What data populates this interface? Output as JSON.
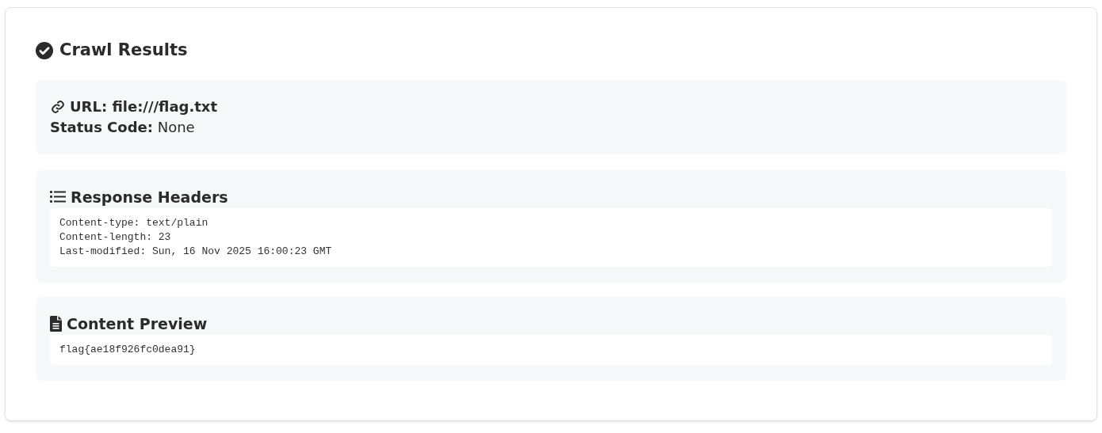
{
  "title": "Crawl Results",
  "summary": {
    "url": "URL: file:///flag.txt",
    "status": "**Status Code:** None"
  },
  "headers": {
    "title": "Response Headers",
    "text": "Content-type: text/plain\nContent-length: 23\nLast-modified: Sun, 16 Nov 2025 16:00:23 GMT"
  },
  "preview": {
    "title": "Content Preview",
    "text": "flag{ae18f926fc0dea91}"
  }
}
